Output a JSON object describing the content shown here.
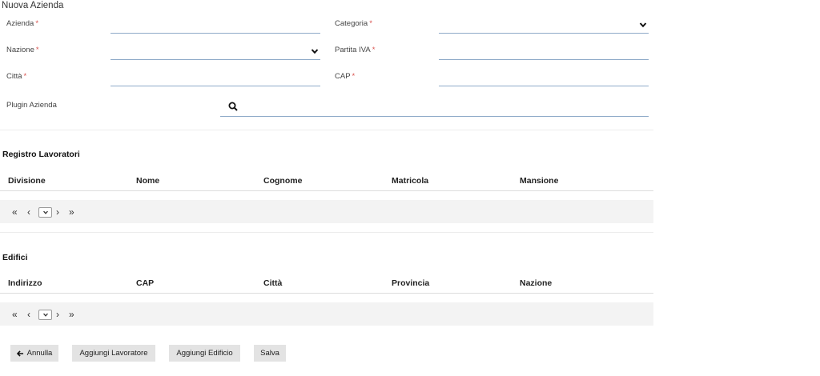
{
  "form": {
    "title": "Nuova Azienda",
    "azienda_label": "Azienda",
    "categoria_label": "Categoria",
    "nazione_label": "Nazione",
    "partita_iva_label": "Partita IVA",
    "citta_label": "Città",
    "cap_label": "CAP",
    "plugin_label": "Plugin Azienda",
    "required_mark": "*",
    "azienda_value": "",
    "categoria_value": "",
    "nazione_value": "",
    "partita_iva_value": "",
    "citta_value": "",
    "cap_value": "",
    "plugin_value": ""
  },
  "registro": {
    "title": "Registro Lavoratori",
    "columns": [
      "Divisione",
      "Nome",
      "Cognome",
      "Matricola",
      "Mansione"
    ]
  },
  "edifici": {
    "title": "Edifici",
    "columns": [
      "Indirizzo",
      "CAP",
      "Città",
      "Provincia",
      "Nazione"
    ]
  },
  "pager": {
    "first": "«",
    "prev": "‹",
    "next": "›",
    "last": "»",
    "icon": "chevron-down-icon"
  },
  "actions": {
    "annulla": "Annulla",
    "aggiungi_lavoratore": "Aggiungi Lavoratore",
    "aggiungi_edificio": "Aggiungi Edificio",
    "salva": "Salva"
  },
  "colors": {
    "required": "#d9534f",
    "field_underline": "#8eaac8",
    "button_bg": "#e3e3e3",
    "pager_bg": "#f3f3f3"
  }
}
